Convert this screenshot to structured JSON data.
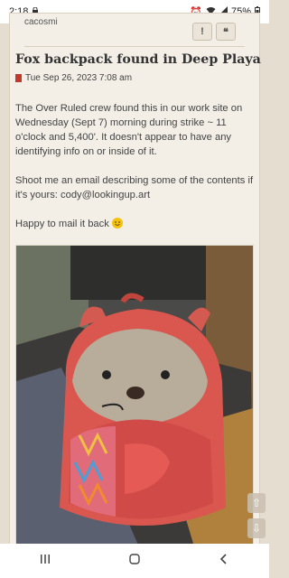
{
  "status_bar": {
    "time": "2:18",
    "battery": "75%"
  },
  "post": {
    "username": "cacosmi",
    "title": "Fox backpack found in Deep Playa",
    "date": "Tue Sep 26, 2023 7:08 am",
    "paragraph1": "The Over Ruled crew found this in our work site on Wednesday (Sept 7) morning during strike ~ 11 o'clock and 5,400'. It doesn't appear to have any identifying info on or inside of it.",
    "paragraph2": "Shoot me an email describing some of the contents if it's yours: cody@lookingup.art",
    "paragraph3": "Happy to mail it back",
    "buttons": {
      "report": "!",
      "quote": "❝"
    }
  },
  "icons": [
    "lock-icon",
    "alarm-icon",
    "wifi-icon",
    "signal-icon",
    "battery-icon",
    "report-icon",
    "quote-icon",
    "document-icon",
    "smile-emoji-icon",
    "scroll-up-icon",
    "scroll-down-icon",
    "recent-apps-icon",
    "home-icon",
    "back-icon"
  ]
}
